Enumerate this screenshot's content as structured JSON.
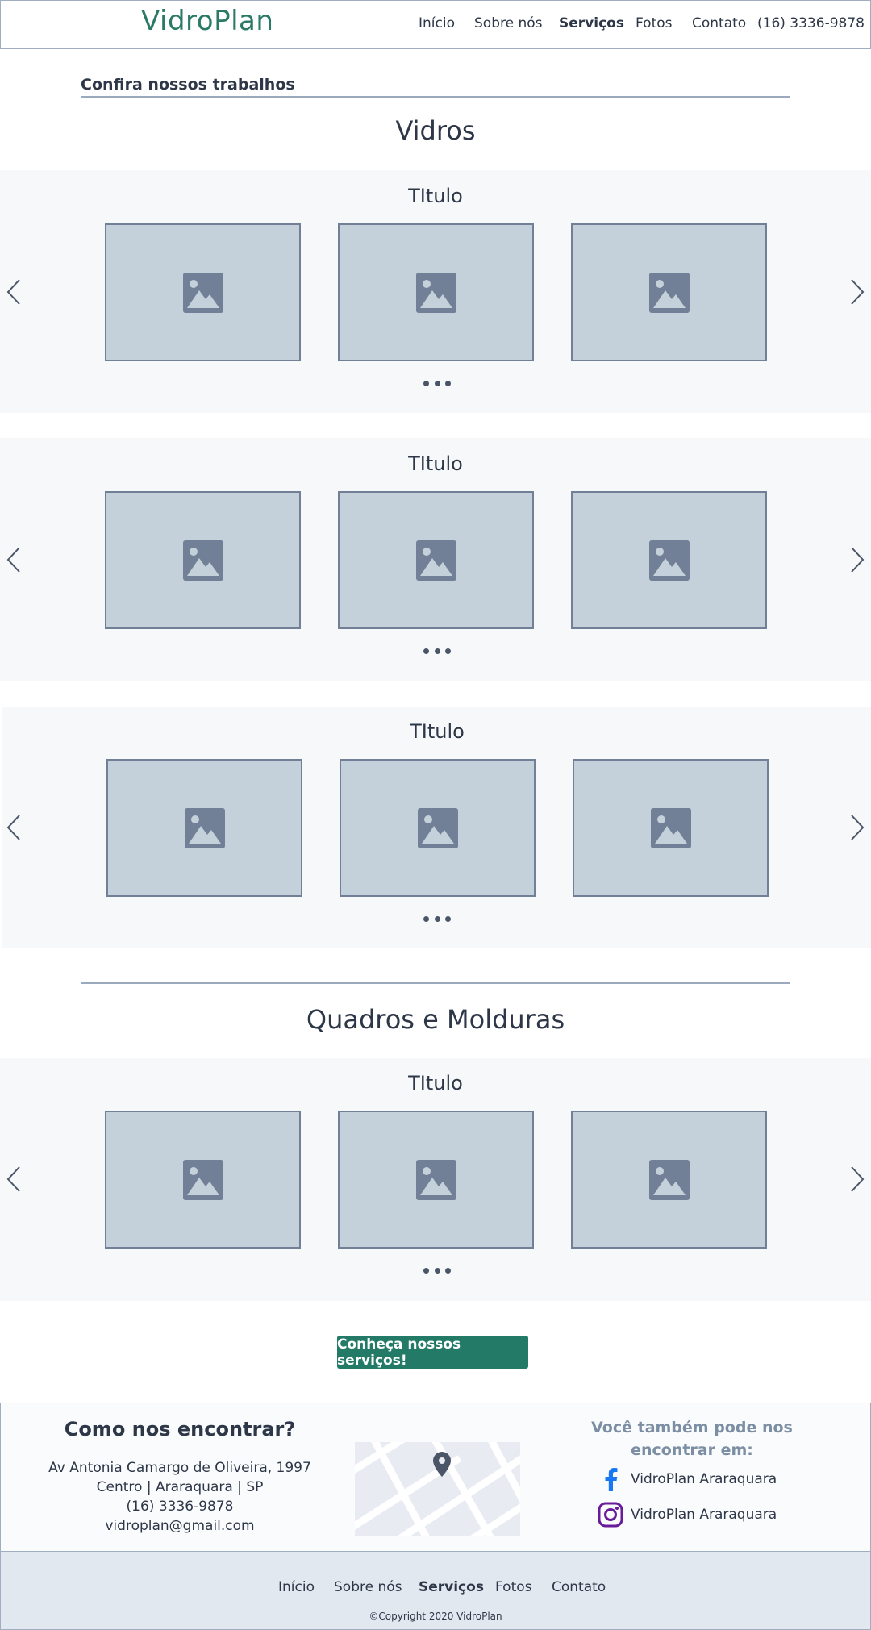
{
  "header": {
    "logo": "VidroPlan",
    "nav": [
      {
        "label": "Início",
        "active": false
      },
      {
        "label": "Sobre nós",
        "active": false
      },
      {
        "label": "Serviços",
        "active": true
      },
      {
        "label": "Fotos",
        "active": false
      },
      {
        "label": "Contato",
        "active": false
      }
    ],
    "phone": "(16) 3336-9878"
  },
  "main": {
    "subtitle": "Confira nossos trabalhos",
    "categories": [
      {
        "title": "Vidros",
        "carousels": [
          {
            "title": "TItulo"
          },
          {
            "title": "TItulo"
          },
          {
            "title": "TItulo"
          }
        ]
      },
      {
        "title": "Quadros e Molduras",
        "carousels": [
          {
            "title": "TItulo"
          }
        ]
      }
    ],
    "cta_label": "Conheça nossos serviços!"
  },
  "footer": {
    "find_title": "Como nos encontrar?",
    "address_lines": [
      "Av Antonia Camargo de Oliveira, 1997",
      "Centro | Araraquara | SP",
      "(16) 3336-9878",
      "vidroplan@gmail.com"
    ],
    "also_title": "Você também pode nos encontrar em:",
    "social": [
      {
        "network": "facebook",
        "icon": "facebook-icon",
        "label": "VidroPlan Araraquara",
        "color": "#1877f2"
      },
      {
        "network": "instagram",
        "icon": "instagram-icon",
        "label": "VidroPlan Araraquara",
        "color": "#6a1b9a"
      }
    ],
    "nav": [
      {
        "label": "Início",
        "active": false
      },
      {
        "label": "Sobre nós",
        "active": false
      },
      {
        "label": "Serviços",
        "active": true
      },
      {
        "label": "Fotos",
        "active": false
      },
      {
        "label": "Contato",
        "active": false
      }
    ],
    "copyright": "©Copyright 2020 VidroPlan"
  },
  "colors": {
    "brand": "#2a7a66",
    "cta": "#227a67",
    "placeholder_bg": "#c4d0da",
    "placeholder_icon": "#718096",
    "footer_bg": "#e2e8f0"
  }
}
